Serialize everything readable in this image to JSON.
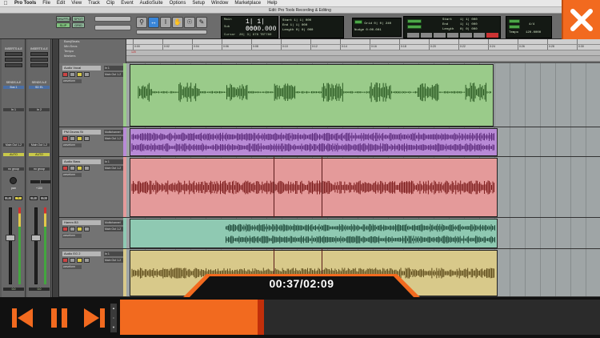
{
  "menubar": {
    "items": [
      "Pro Tools",
      "File",
      "Edit",
      "View",
      "Track",
      "Clip",
      "Event",
      "AudioSuite",
      "Options",
      "Setup",
      "Window",
      "Marketplace",
      "Help"
    ]
  },
  "window_title": "Edit: Pro Tools Recording & Editing",
  "toolbar": {
    "mode_buttons": [
      "SHUFFLE",
      "SPOT",
      "SLIP",
      "GRID"
    ],
    "counter": {
      "main_label": "Main",
      "main_value": "1| 1| 000",
      "sub_label": "Sub",
      "sub_value": "0:00.000",
      "cursor_label": "Cursor",
      "cursor_value": "26| 3| 978",
      "extra": "TBT780"
    },
    "selection": {
      "start_label": "Start",
      "start_value": "1| 1| 000",
      "end_label": "End",
      "end_value": "1| 1| 000",
      "length_label": "Length",
      "length_value": "0| 0| 000"
    },
    "grid_label": "Grid",
    "grid_value": "0| 0| 240",
    "nudge_label": "Nudge",
    "nudge_value": "0:00.001",
    "counter2": {
      "start_label": "Start",
      "end_label": "End",
      "length_label": "Length",
      "start_value": "1| 1| 000",
      "end_value": "1| 1| 000",
      "length_value": "0| 0| 000",
      "tempo_label": "Tempo",
      "tempo_value": "120.0000",
      "meter_value": "4/4"
    }
  },
  "rulers": {
    "labels": [
      "Bars|Beats",
      "Min:Secs",
      "Tempo",
      "Markers"
    ],
    "minsecs": [
      "0:00",
      "0:02",
      "0:04",
      "0:06",
      "0:08",
      "0:10",
      "0:12",
      "0:14",
      "0:16",
      "0:18",
      "0:20",
      "0:22",
      "0:24",
      "0:26",
      "0:28",
      "0:30"
    ],
    "tempo_marker": "120"
  },
  "mixer": {
    "strip_a": {
      "inserts": "INSERTS A-E",
      "sends": "SENDS A-E",
      "io": "Bus 1",
      "input": "In 1",
      "output": "Main Out 1-2",
      "automation": "AUTO",
      "group": "no group",
      "pan": "pan",
      "vol": "0.0",
      "mute": "M",
      "solo": "S"
    },
    "strip_b": {
      "inserts": "INSERTS A-E",
      "sends": "SENDS A-E",
      "io": "SD EL",
      "input": "In 2",
      "output": "Main Out 1-2",
      "automation": "AUTO",
      "group": "no group",
      "pan": "+100",
      "vol": "0.0",
      "mute": "M",
      "solo": "S"
    }
  },
  "tracks": [
    {
      "name": "Audio Vocal",
      "input": "In 1",
      "output": "Main Out 1-2",
      "mode": "waveform",
      "color": "#9acb8a"
    },
    {
      "name": "PM Drums St",
      "input": "Multichannel",
      "output": "Main Out 1-2",
      "mode": "waveform",
      "color": "#b88ad6"
    },
    {
      "name": "Audio Bass",
      "input": "In 1",
      "output": "Main Out 1-2",
      "mode": "waveform",
      "color": "#e49a9a"
    },
    {
      "name": "Hamm B3",
      "input": "Multichannel",
      "output": "Main Out 1-2",
      "mode": "waveform",
      "color": "#8fc9b2"
    },
    {
      "name": "Audio EG 2",
      "input": "In 1",
      "output": "Main Out 1-2",
      "mode": "waveform",
      "color": "#d8c98a"
    }
  ],
  "player": {
    "time_display": "00:37/02:09",
    "progress": 0.3,
    "prev_icon": "skip-back-icon",
    "pause_icon": "pause-icon",
    "next_icon": "skip-forward-icon",
    "close_icon": "close-icon",
    "accent": "#f26a1f"
  }
}
